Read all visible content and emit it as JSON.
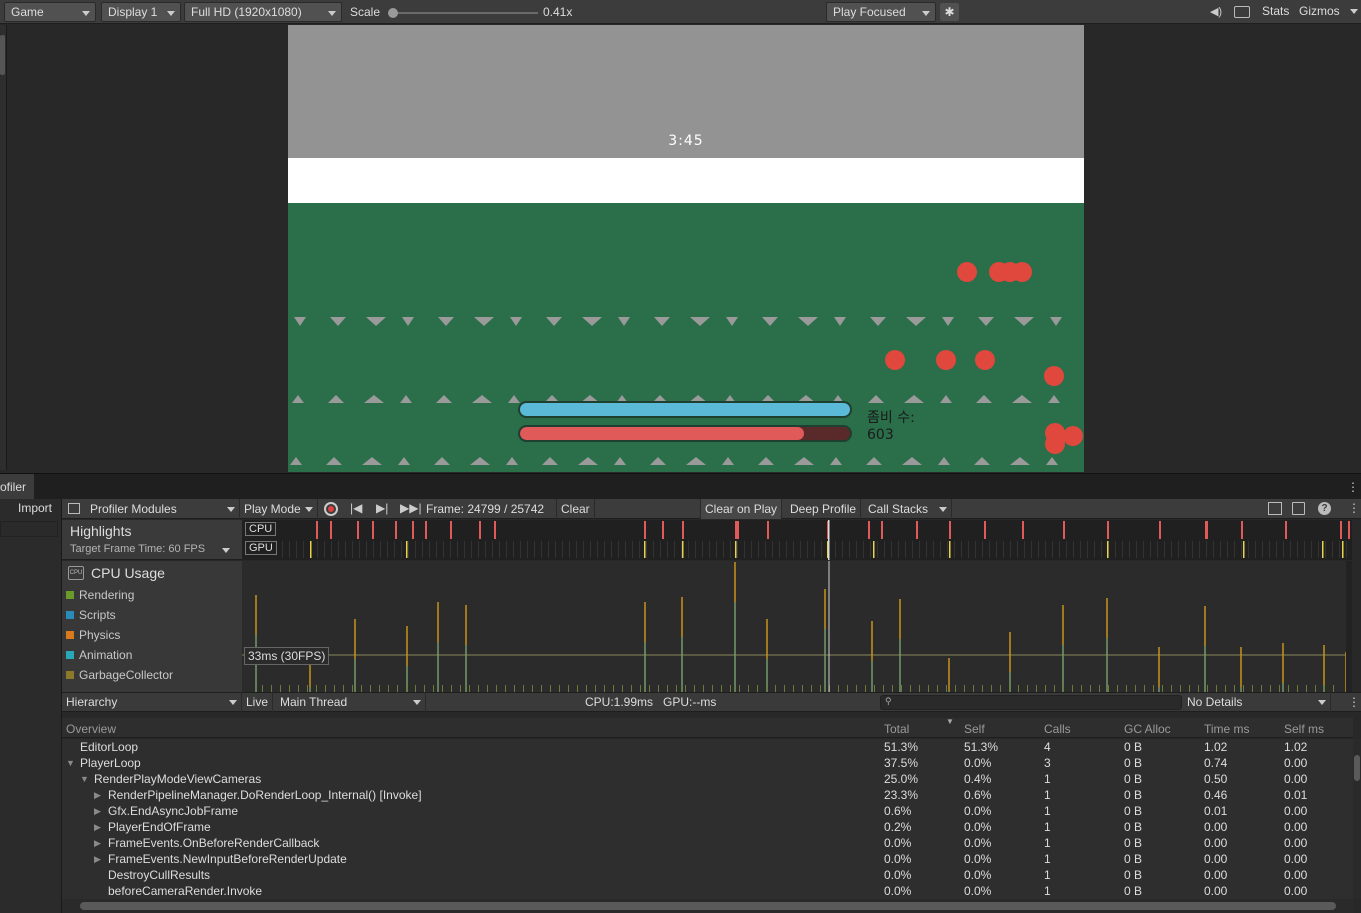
{
  "toolbar": {
    "view_select": "Game",
    "display_select": "Display 1",
    "resolution_select": "Full HD (1920x1080)",
    "scale_label": "Scale",
    "scale_value": "0.41x",
    "scale_level": 0.0,
    "play_mode_select": "Play Focused",
    "stats_label": "Stats",
    "gizmos_label": "Gizmos"
  },
  "game": {
    "timer": "3:45",
    "zombie_count_label": "좀비 수:\n603",
    "blue_bar_level": 1.0,
    "red_bar_level": 0.86,
    "colors": {
      "sky": "#939393",
      "field": "#2a6e4a",
      "zombie": "#e0483e",
      "blue_bar": "#5bbad8",
      "red_bar": "#e05a5a"
    }
  },
  "profiler": {
    "tab_label": "ofiler",
    "import_label": "Import",
    "modules_label": "Profiler Modules",
    "play_mode_label": "Play Mode",
    "frame_label": "Frame: 24799 / 25742",
    "clear_label": "Clear",
    "clear_on_play_label": "Clear on Play",
    "deep_profile_label": "Deep Profile",
    "call_stacks_label": "Call Stacks",
    "highlights_title": "Highlights",
    "target_frame_label": "Target Frame Time: 60 FPS",
    "cpu_tag": "CPU",
    "gpu_tag": "GPU",
    "cpu_usage_title": "CPU Usage",
    "cpu_icon_text": "CPU",
    "legend": [
      {
        "label": "Rendering",
        "color": "#6a9a2a"
      },
      {
        "label": "Scripts",
        "color": "#2a8ab8"
      },
      {
        "label": "Physics",
        "color": "#d87a1a"
      },
      {
        "label": "Animation",
        "color": "#2aa8b8"
      },
      {
        "label": "GarbageCollector",
        "color": "#8a7a2a"
      }
    ],
    "threshold_label": "33ms (30FPS)",
    "hierarchy_select": "Hierarchy",
    "live_label": "Live",
    "thread_select": "Main Thread",
    "cpu_gpu_label": "CPU:1.99ms   GPU:--ms",
    "details_select": "No Details",
    "columns": [
      "Overview",
      "Total",
      "Self",
      "Calls",
      "GC Alloc",
      "Time ms",
      "Self ms"
    ],
    "rows": [
      {
        "name": "EditorLoop",
        "indent": 0,
        "arrow": "",
        "total": "51.3%",
        "self": "51.3%",
        "calls": "4",
        "gc": "0 B",
        "time": "1.02",
        "selfms": "1.02"
      },
      {
        "name": "PlayerLoop",
        "indent": 0,
        "arrow": "▼",
        "total": "37.5%",
        "self": "0.0%",
        "calls": "3",
        "gc": "0 B",
        "time": "0.74",
        "selfms": "0.00"
      },
      {
        "name": "RenderPlayModeViewCameras",
        "indent": 1,
        "arrow": "▼",
        "total": "25.0%",
        "self": "0.4%",
        "calls": "1",
        "gc": "0 B",
        "time": "0.50",
        "selfms": "0.00"
      },
      {
        "name": "RenderPipelineManager.DoRenderLoop_Internal() [Invoke]",
        "indent": 2,
        "arrow": "▶",
        "total": "23.3%",
        "self": "0.6%",
        "calls": "1",
        "gc": "0 B",
        "time": "0.46",
        "selfms": "0.01"
      },
      {
        "name": "Gfx.EndAsyncJobFrame",
        "indent": 2,
        "arrow": "▶",
        "total": "0.6%",
        "self": "0.0%",
        "calls": "1",
        "gc": "0 B",
        "time": "0.01",
        "selfms": "0.00"
      },
      {
        "name": "PlayerEndOfFrame",
        "indent": 2,
        "arrow": "▶",
        "total": "0.2%",
        "self": "0.0%",
        "calls": "1",
        "gc": "0 B",
        "time": "0.00",
        "selfms": "0.00"
      },
      {
        "name": "FrameEvents.OnBeforeRenderCallback",
        "indent": 2,
        "arrow": "▶",
        "total": "0.0%",
        "self": "0.0%",
        "calls": "1",
        "gc": "0 B",
        "time": "0.00",
        "selfms": "0.00"
      },
      {
        "name": "FrameEvents.NewInputBeforeRenderUpdate",
        "indent": 2,
        "arrow": "▶",
        "total": "0.0%",
        "self": "0.0%",
        "calls": "1",
        "gc": "0 B",
        "time": "0.00",
        "selfms": "0.00"
      },
      {
        "name": "DestroyCullResults",
        "indent": 2,
        "arrow": "",
        "total": "0.0%",
        "self": "0.0%",
        "calls": "1",
        "gc": "0 B",
        "time": "0.00",
        "selfms": "0.00"
      },
      {
        "name": "beforeCameraRender.Invoke",
        "indent": 2,
        "arrow": "",
        "total": "0.0%",
        "self": "0.0%",
        "calls": "1",
        "gc": "0 B",
        "time": "0.00",
        "selfms": "0.00"
      }
    ]
  }
}
